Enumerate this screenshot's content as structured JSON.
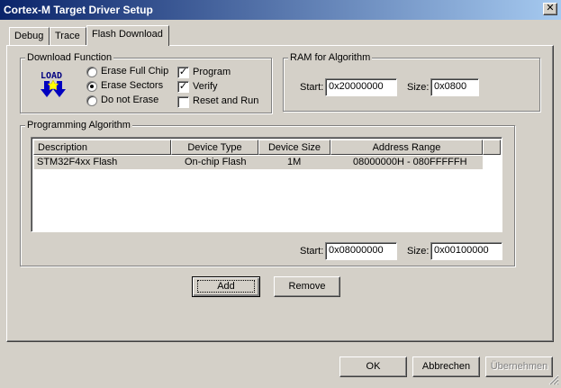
{
  "window": {
    "title": "Cortex-M Target Driver Setup"
  },
  "tabs": [
    {
      "label": "Debug"
    },
    {
      "label": "Trace"
    },
    {
      "label": "Flash Download"
    }
  ],
  "download_function": {
    "title": "Download Function",
    "icon_text": "LOAD",
    "radios": [
      {
        "label": "Erase Full Chip",
        "checked": false
      },
      {
        "label": "Erase Sectors",
        "checked": true
      },
      {
        "label": "Do not Erase",
        "checked": false
      }
    ],
    "checks": [
      {
        "label": "Program",
        "checked": true
      },
      {
        "label": "Verify",
        "checked": true
      },
      {
        "label": "Reset and Run",
        "checked": false
      }
    ]
  },
  "ram": {
    "title": "RAM for Algorithm",
    "start_label": "Start:",
    "start_value": "0x20000000",
    "size_label": "Size:",
    "size_value": "0x0800"
  },
  "programming": {
    "title": "Programming Algorithm",
    "columns": [
      "Description",
      "Device Type",
      "Device Size",
      "Address Range"
    ],
    "rows": [
      {
        "description": "STM32F4xx Flash",
        "device_type": "On-chip Flash",
        "device_size": "1M",
        "address_range": "08000000H - 080FFFFFH"
      }
    ],
    "start_label": "Start:",
    "start_value": "0x08000000",
    "size_label": "Size:",
    "size_value": "0x00100000",
    "add_label": "Add",
    "remove_label": "Remove"
  },
  "footer": {
    "ok_label": "OK",
    "cancel_label": "Abbrechen",
    "apply_label": "Übernehmen"
  }
}
